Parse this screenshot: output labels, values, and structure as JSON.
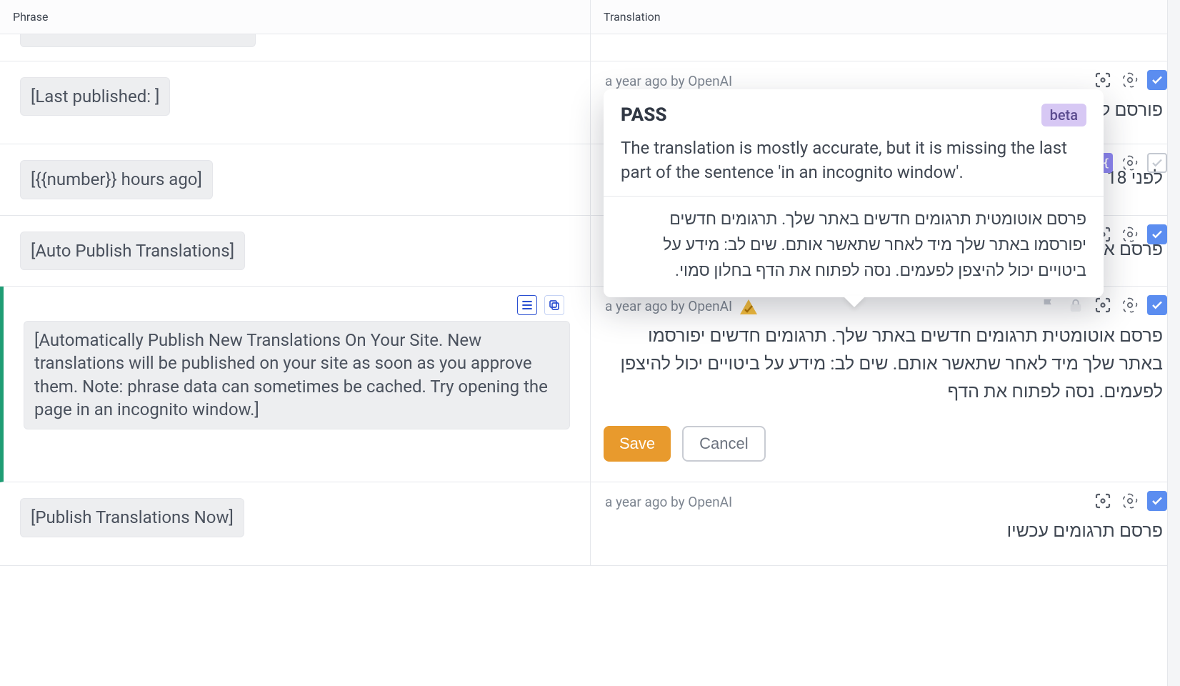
{
  "headers": {
    "phrase": "Phrase",
    "translation": "Translation"
  },
  "popover": {
    "status": "PASS",
    "badge": "beta",
    "explanation": "The translation is mostly accurate, but it is missing the last part of the sentence 'in an incognito window'.",
    "reference_hebrew": "פרסם אוטומטית תרגומים חדשים באתר שלך. תרגומים חדשים יפורסמו באתר שלך מיד לאחר שתאשר אותם. שים לב: מידע על ביטויים יכול להיצפן לפעמים. נסה לפתוח את הדף בחלון סמוי."
  },
  "rows": [
    {
      "phrase": "[Last published: ]",
      "meta": "a year ago by OpenAI",
      "translation": "פורסם לאחרונה:",
      "approved": true,
      "has_vars": false
    },
    {
      "phrase": "[{{number}} hours ago]",
      "meta": "",
      "translation": "לפני 18 שעות",
      "approved": false,
      "has_vars": true
    },
    {
      "phrase": "[Auto Publish Translations]",
      "meta": "",
      "translation": "פרסם אוטומטית תו",
      "approved": true,
      "has_vars": false
    },
    {
      "phrase": "[Automatically Publish New Translations On Your Site. New translations will be published on your site as soon as you approve them. Note: phrase data can sometimes be cached. Try opening the page in an incognito window.]",
      "meta": "a year ago by OpenAI",
      "translation_edit": "פרסם אוטומטית תרגומים חדשים באתר שלך. תרגומים חדשים יפורסמו באתר שלך מיד לאחר שתאשר אותם. שים לב: מידע על ביטויים יכול להיצפן לפעמים. נסה לפתוח את הדף",
      "approved": true,
      "selected": true
    },
    {
      "phrase": "[Publish Translations Now]",
      "meta": "a year ago by OpenAI",
      "translation": "פרסם תרגומים עכשיו",
      "approved": true
    }
  ],
  "buttons": {
    "save": "Save",
    "cancel": "Cancel"
  },
  "icons": {
    "focus": "focus-icon",
    "ai": "ai-icon",
    "check": "check-icon",
    "vars": "vars-icon",
    "flag": "flag-icon",
    "lock": "lock-icon",
    "list": "list-icon",
    "copy": "copy-icon",
    "warn": "warn-icon"
  }
}
